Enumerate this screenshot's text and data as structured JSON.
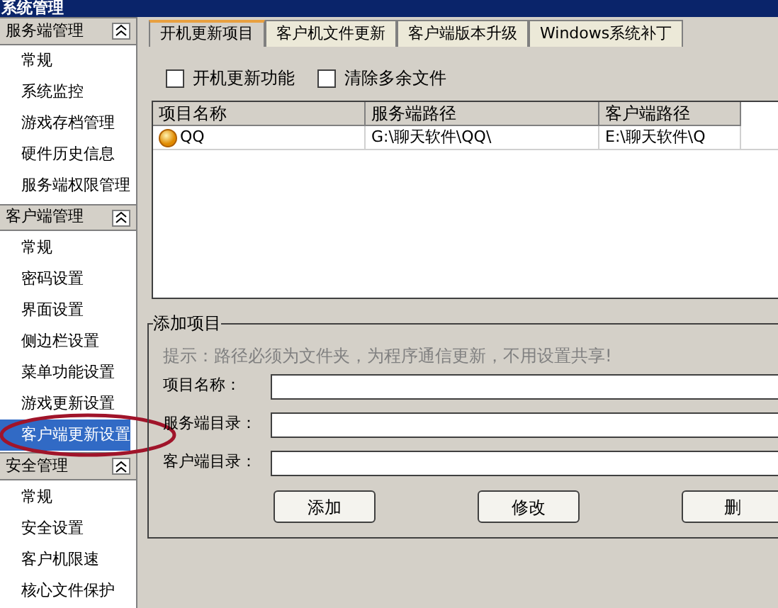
{
  "window": {
    "title": "系统管理"
  },
  "sidebar": {
    "sections": [
      {
        "title": "服务端管理",
        "expanded": true,
        "items": [
          {
            "label": "常规",
            "selected": false
          },
          {
            "label": "系统监控",
            "selected": false
          },
          {
            "label": "游戏存档管理",
            "selected": false
          },
          {
            "label": "硬件历史信息",
            "selected": false
          },
          {
            "label": "服务端权限管理",
            "selected": false
          }
        ]
      },
      {
        "title": "客户端管理",
        "expanded": true,
        "items": [
          {
            "label": "常规",
            "selected": false
          },
          {
            "label": "密码设置",
            "selected": false
          },
          {
            "label": "界面设置",
            "selected": false
          },
          {
            "label": "侧边栏设置",
            "selected": false
          },
          {
            "label": "菜单功能设置",
            "selected": false
          },
          {
            "label": "游戏更新设置",
            "selected": false
          },
          {
            "label": "客户端更新设置",
            "selected": true
          }
        ]
      },
      {
        "title": "安全管理",
        "expanded": true,
        "items": [
          {
            "label": "常规",
            "selected": false
          },
          {
            "label": "安全设置",
            "selected": false
          },
          {
            "label": "客户机限速",
            "selected": false
          },
          {
            "label": "核心文件保护",
            "selected": false
          }
        ]
      }
    ]
  },
  "tabs": [
    {
      "label": "开机更新项目",
      "selected": true
    },
    {
      "label": "客户机文件更新",
      "selected": false
    },
    {
      "label": "客户端版本升级",
      "selected": false
    },
    {
      "label": "Windows系统补丁",
      "selected": false
    }
  ],
  "options": [
    {
      "label": "开机更新功能",
      "checked": false
    },
    {
      "label": "清除多余文件",
      "checked": false
    }
  ],
  "table": {
    "columns": [
      "项目名称",
      "服务端路径",
      "客户端路径"
    ],
    "rows": [
      {
        "cells": [
          "QQ",
          "G:\\聊天软件\\QQ\\",
          "E:\\聊天软件\\Q"
        ]
      }
    ]
  },
  "add_group": {
    "title": "添加项目",
    "hint": "提示：路径必须为文件夹，为程序通信更新，不用设置共享!",
    "fields": [
      {
        "label": "项目名称："
      },
      {
        "label": "服务端目录："
      },
      {
        "label": "客户端目录："
      }
    ],
    "buttons": [
      "添加",
      "修改",
      "删"
    ]
  }
}
